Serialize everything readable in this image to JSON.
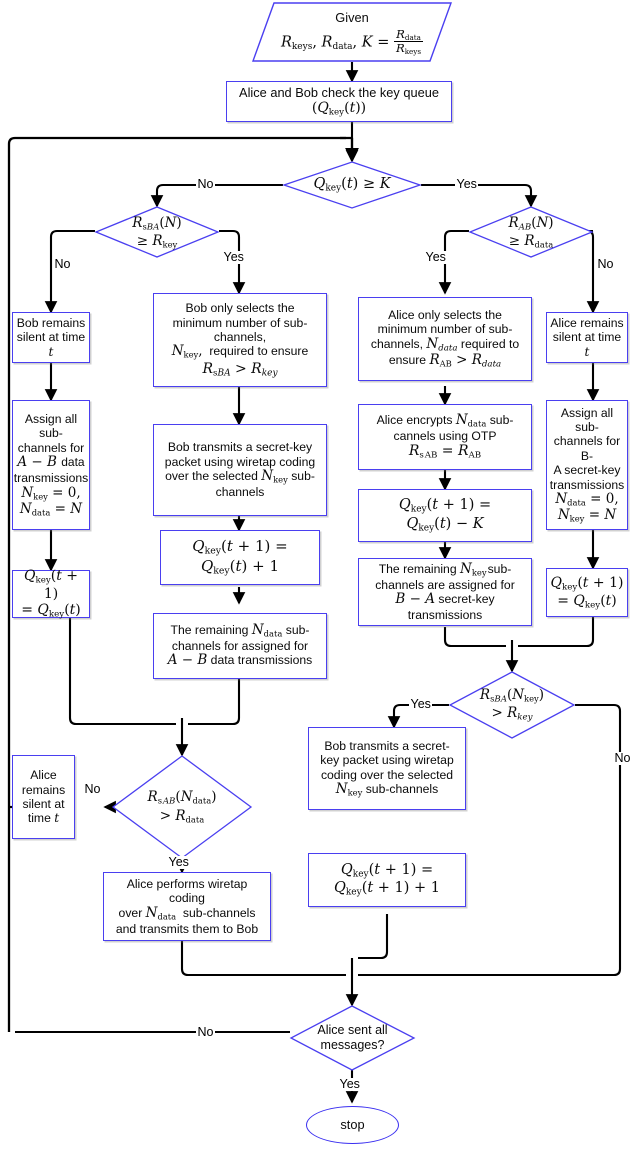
{
  "diagram": {
    "title": "Flowchart of the secret-key queue / data transmission protocol",
    "colors": {
      "node_border": "#4a3ff0",
      "edge": "#000000",
      "background": "#ffffff"
    },
    "start": {
      "label": "Given",
      "line2": "R_keys, R_data, K = R_data / R_keys"
    },
    "nodes": {
      "given_line1": "Given",
      "check_queue_line1": "Alice and Bob check the key queue",
      "check_queue_line2": "(Q_key(t))",
      "d_queue": "Q_key(t) ≥ K",
      "d_rsba_n": "R_sBA(N) ≥ R_key",
      "d_rab_n": "R_AB(N) ≥ R_data",
      "bob_silent": "Bob remains silent at time t",
      "assign_all_ab_l1": "Assign all sub-",
      "assign_all_ab_l2": "channels for",
      "assign_all_ab_l3": "A − B data",
      "assign_all_ab_l4": "transmissions",
      "assign_all_ab_l5": "N_key = 0,",
      "assign_all_ab_l6": "N_data = N",
      "q_same_left": "Q_key(t+1) = Q_key(t)",
      "bob_selects_l1": "Bob only selects the",
      "bob_selects_l2": "minimum number of sub-",
      "bob_selects_l3": "channels,",
      "bob_selects_l4": "N_key , required to ensure",
      "bob_selects_l5": "R_sBA > R_key",
      "bob_transmits_l1": "Bob transmits a secret-key",
      "bob_transmits_l2": "packet using wiretap coding",
      "bob_transmits_l3": "over the selected N_key sub-",
      "bob_transmits_l4": "channels",
      "q_plus1_left": "Q_key(t+1) = Q_key(t) + 1",
      "remaining_ndata_l1": "The remaining N_data sub-",
      "remaining_ndata_l2": "channels for assigned for",
      "remaining_ndata_l3": "A − B data transmissions",
      "alice_selects_l1": "Alice only selects the",
      "alice_selects_l2": "minimum number of sub-",
      "alice_selects_l3": "channels, N_data required to",
      "alice_selects_l4": "ensure R_AB > R_data",
      "alice_encrypts_l1": "Alice encrypts N_data sub-",
      "alice_encrypts_l2": "cannels using OTP",
      "alice_encrypts_l3": "R_sAB = R_AB",
      "q_minus_k": "Q_key(t+1) = Q_key(t) − K",
      "remaining_nkey_l1": "The remaining N_key sub-",
      "remaining_nkey_l2": "channels are assigned for",
      "remaining_nkey_l3": "B − A secret-key",
      "remaining_nkey_l4": "transmissions",
      "alice_silent": "Alice remains silent at time t",
      "assign_all_ba_l1": "Assign all sub-",
      "assign_all_ba_l2": "channels for B-",
      "assign_all_ba_l3": "A secret-key",
      "assign_all_ba_l4": "transmissions",
      "assign_all_ba_l5": "N_data = 0,",
      "assign_all_ba_l6": "N_key = N",
      "q_same_right": "Q_key(t+1) = Q_key(t)",
      "d_rsba_nkey": "R_sBA(N_key) > R_key",
      "bob_transmits2_l1": "Bob transmits a secret-",
      "bob_transmits2_l2": "key packet using wiretap",
      "bob_transmits2_l3": "coding over the selected",
      "bob_transmits2_l4": "N_key sub-channels",
      "q_plus1_right": "Q_key(t+1) = Q_key(t+1) + 1",
      "d_rsab_ndata": "R_sAB(N_data) > R_data",
      "alice_silent2_l1": "Alice",
      "alice_silent2_l2": "remains",
      "alice_silent2_l3": "silent at",
      "alice_silent2_l4": "time t",
      "alice_wiretap_l1": "Alice performs wiretap",
      "alice_wiretap_l2": "coding",
      "alice_wiretap_l3": "over N_data  sub-channels",
      "alice_wiretap_l4": "and transmits them to Bob",
      "d_alice_sent_l1": "Alice sent all",
      "d_alice_sent_l2": "messages?",
      "stop": "stop"
    },
    "edge_labels": {
      "queue_no": "No",
      "queue_yes": "Yes",
      "rsba_no": "No",
      "rsba_yes": "Yes",
      "rab_yes": "Yes",
      "rab_no": "No",
      "rsba_nkey_yes": "Yes",
      "rsba_nkey_no": "No",
      "rsab_ndata_no": "No",
      "rsab_ndata_yes": "Yes",
      "alice_sent_no": "No",
      "alice_sent_yes": "Yes"
    }
  }
}
